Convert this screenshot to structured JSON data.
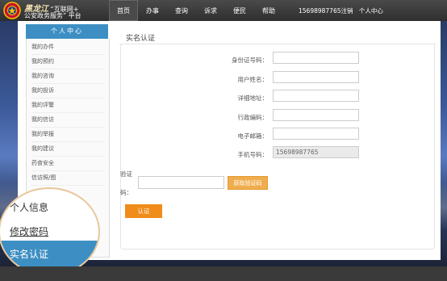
{
  "brand": {
    "province": "黑龙江",
    "line1_rest": "“互联网+",
    "line2": "公安政务服务” 平台"
  },
  "nav": {
    "items": [
      "首页",
      "办事",
      "查询",
      "诉求",
      "便民",
      "帮助"
    ],
    "active_index": 0
  },
  "user": {
    "phone_logout": "15698987765注销",
    "center": "个人中心"
  },
  "sidebar": {
    "title": "个人中心",
    "items": [
      "我的办件",
      "我的预约",
      "我的咨询",
      "我的投诉",
      "我的评警",
      "我的信访",
      "我的举报",
      "我的建议",
      "药食安全",
      "信访照/图"
    ]
  },
  "main": {
    "title": "实名认证"
  },
  "form": {
    "id_label": "身份证号码：",
    "name_label": "用户姓名：",
    "address_label": "详细地址：",
    "area_label": "行政编码：",
    "email_label": "电子邮箱：",
    "phone_label": "手机号码：",
    "phone_value": "15698987765",
    "verify_label_top": "验证",
    "verify_label_bottom": "码：",
    "get_code_label": "获取验证码",
    "submit_label": "认证"
  },
  "zoom": {
    "item1": "个人信息",
    "item2": "修改密码",
    "active": "实名认证"
  }
}
